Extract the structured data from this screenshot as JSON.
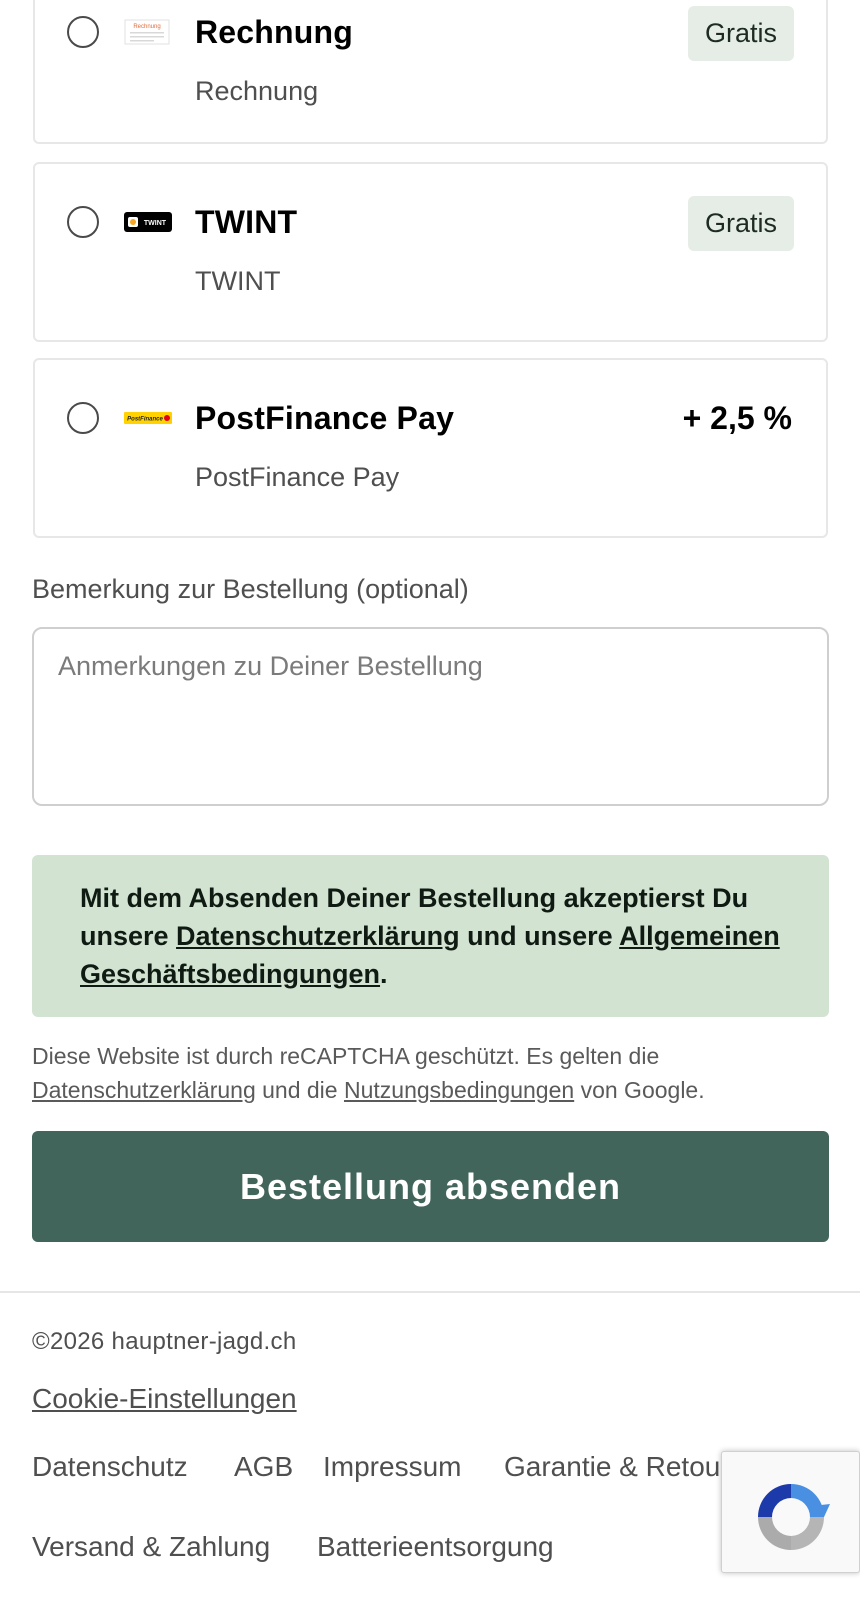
{
  "payment_methods": [
    {
      "title": "Rechnung",
      "subtitle": "Rechnung",
      "badge": "Gratis",
      "logo_text": "Rechnung",
      "logo": "invoice-logo"
    },
    {
      "title": "TWINT",
      "subtitle": "TWINT",
      "badge": "Gratis",
      "logo_text": "TWINT",
      "logo": "twint-logo"
    },
    {
      "title": "PostFinance Pay",
      "subtitle": "PostFinance Pay",
      "fee": "+ 2,5 %",
      "logo_text": "PostFinance",
      "logo": "postfinance-logo"
    }
  ],
  "remark": {
    "label": "Bemerkung zur Bestellung (optional)",
    "placeholder": "Anmerkungen zu Deiner Bestellung",
    "value": ""
  },
  "notice": {
    "text_1": "Mit dem Absenden Deiner Bestellung akzeptierst Du unsere ",
    "privacy_link": "Datenschutzerklärung",
    "text_2": " und unsere ",
    "terms_link": "Allgemeinen Geschäftsbedingungen",
    "text_3": "."
  },
  "recaptcha_notice": {
    "text_1": "Diese Website ist durch reCAPTCHA geschützt. Es gelten die ",
    "privacy_link": "Datenschutzerklärung",
    "text_2": " und die ",
    "terms_link": "Nutzungsbedingungen",
    "text_3": " von Google."
  },
  "submit_label": "Bestellung absenden",
  "footer": {
    "copyright": "©2026 hauptner-jagd.ch",
    "cookie_link": "Cookie-Einstellungen",
    "links": [
      "Datenschutz",
      "AGB",
      "Impressum",
      "Garantie & Retouren",
      "Versand & Zahlung",
      "Batterieentsorgung"
    ]
  },
  "colors": {
    "accent": "#41655a",
    "badge_bg": "#e6ede6",
    "notice_bg": "#d3e3d2",
    "card_border": "#e7e7e7",
    "postfinance_yellow": "#ffd200"
  }
}
